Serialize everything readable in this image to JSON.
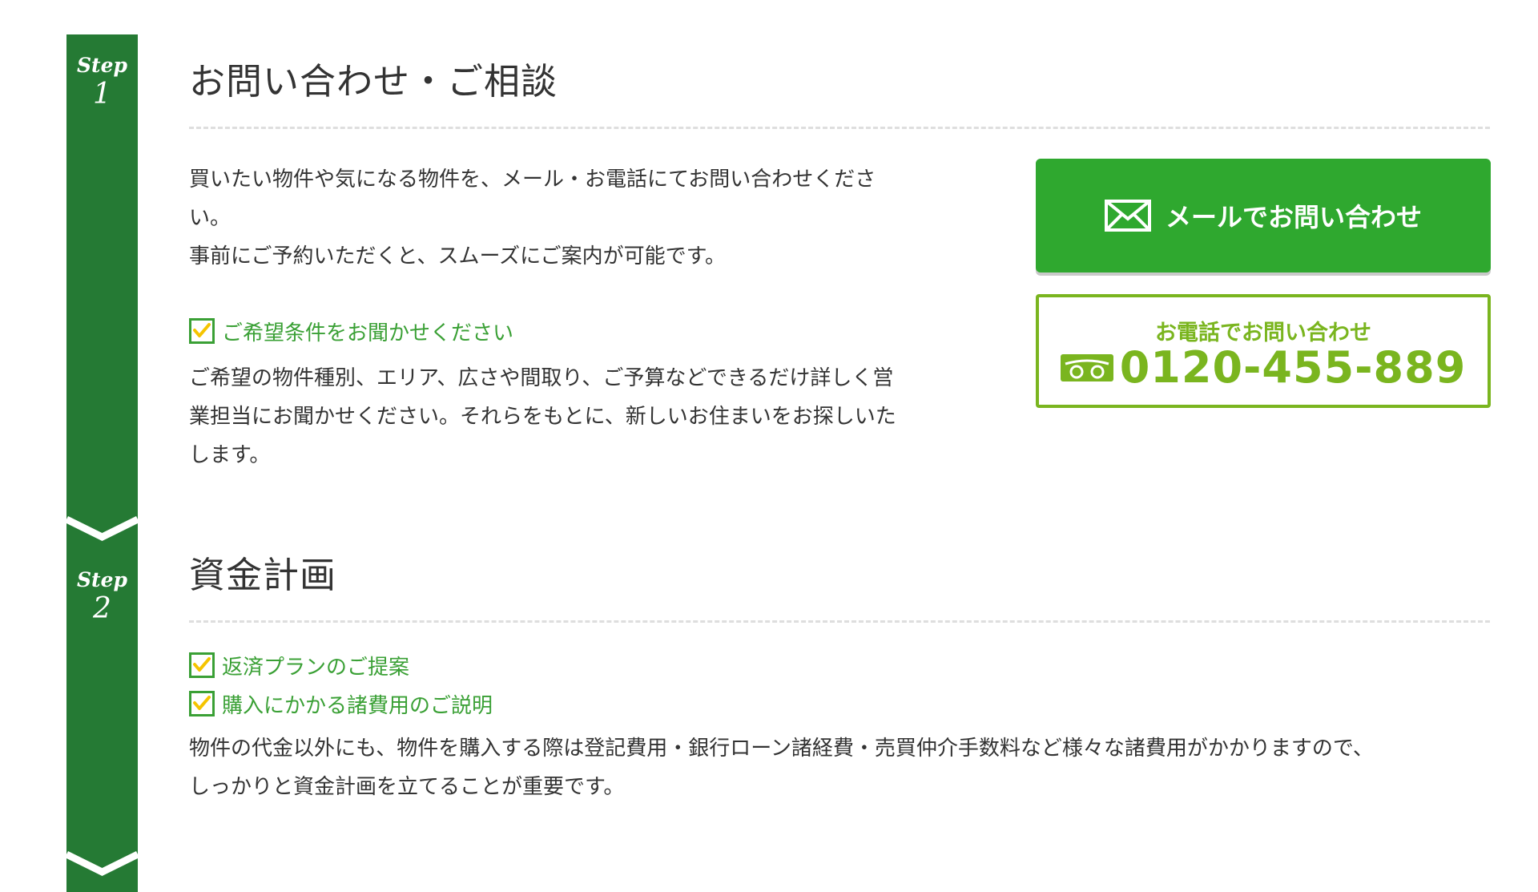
{
  "steps": [
    {
      "step_word": "Step",
      "step_number": "1",
      "title": "お問い合わせ・ご相談",
      "intro_lines": [
        "買いたい物件や気になる物件を、メール・お電話にてお問い合わせくださ",
        "い。",
        "事前にご予約いただくと、スムーズにご案内が可能です。"
      ],
      "check_items": [
        "ご希望条件をお聞かせください"
      ],
      "body_lines": [
        "ご希望の物件種別、エリア、広さや間取り、ご予算などできるだけ詳しく営",
        "業担当にお聞かせください。それらをもとに、新しいお住まいをお探しいた",
        "します。"
      ]
    },
    {
      "step_word": "Step",
      "step_number": "2",
      "title": "資金計画",
      "check_items": [
        "返済プランのご提案",
        "購入にかかる諸費用のご説明"
      ],
      "body_lines": [
        "物件の代金以外にも、物件を購入する際は登記費用・銀行ローン諸経費・売買仲介手数料など様々な諸費用がかかりますので、",
        "しっかりと資金計画を立てることが重要です。"
      ]
    }
  ],
  "contact": {
    "mail_button_label": "メールでお問い合わせ",
    "mail_icon": "envelope-icon",
    "tel_heading": "お電話でお問い合わせ",
    "tel_icon": "freedial-icon",
    "tel_number": "0120-455-889"
  },
  "colors": {
    "rail": "#257a34",
    "accent_green": "#3aa035",
    "mail_button": "#2fa82f",
    "tel_green": "#7ab51f",
    "check_mark": "#f5c400"
  }
}
